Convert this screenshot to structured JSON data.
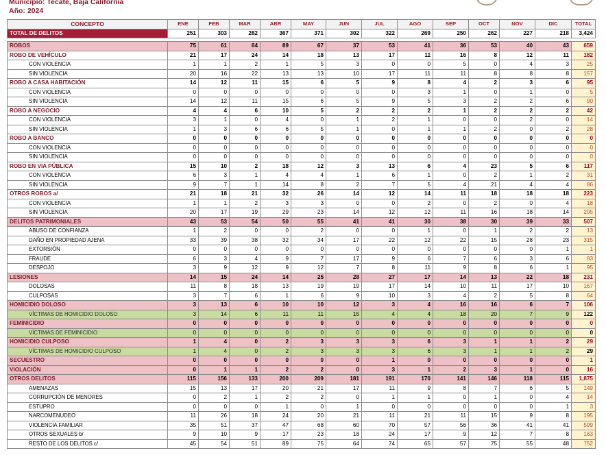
{
  "header": {
    "municipio": "Municipio: Tecate, Baja California",
    "anio": "Año: 2024"
  },
  "table": {
    "headers": [
      "CONCEPTO",
      "ENE",
      "FEB",
      "MAR",
      "ABR",
      "MAY",
      "JUN",
      "JUL",
      "AGO",
      "SEP",
      "OCT",
      "NOV",
      "DIC",
      "TOTAL"
    ],
    "rows": [
      {
        "kind": "grand",
        "label": "TOTAL DE DELITOS",
        "values": [
          "251",
          "303",
          "282",
          "367",
          "371",
          "302",
          "322",
          "269",
          "250",
          "262",
          "227",
          "218"
        ],
        "total": "3,424"
      },
      {
        "kind": "gap"
      },
      {
        "kind": "cat",
        "label": "ROBOS",
        "values": [
          "75",
          "61",
          "64",
          "89",
          "67",
          "37",
          "53",
          "41",
          "36",
          "53",
          "40",
          "43"
        ],
        "total": "659"
      },
      {
        "kind": "sub",
        "label": "ROBO DE VEHÍCULO",
        "values": [
          "21",
          "17",
          "24",
          "14",
          "18",
          "13",
          "17",
          "11",
          "16",
          "8",
          "12",
          "11"
        ],
        "total": "182"
      },
      {
        "kind": "det",
        "label": "CON VIOLENCIA",
        "values": [
          "1",
          "1",
          "2",
          "1",
          "5",
          "3",
          "0",
          "0",
          "5",
          "0",
          "4",
          "3"
        ],
        "total": "25"
      },
      {
        "kind": "det",
        "label": "SIN VIOLENCIA",
        "values": [
          "20",
          "16",
          "22",
          "13",
          "13",
          "10",
          "17",
          "11",
          "11",
          "8",
          "8",
          "8"
        ],
        "total": "157"
      },
      {
        "kind": "sub",
        "label": "ROBO A CASA HABITACIÓN",
        "values": [
          "14",
          "12",
          "11",
          "15",
          "6",
          "5",
          "9",
          "8",
          "4",
          "2",
          "3",
          "6"
        ],
        "total": "95"
      },
      {
        "kind": "det",
        "label": "CON VIOLENCIA",
        "values": [
          "0",
          "0",
          "0",
          "0",
          "0",
          "0",
          "0",
          "3",
          "1",
          "0",
          "1",
          "0"
        ],
        "total": "5"
      },
      {
        "kind": "det",
        "label": "SIN VIOLENCIA",
        "values": [
          "14",
          "12",
          "11",
          "15",
          "6",
          "5",
          "9",
          "5",
          "3",
          "2",
          "2",
          "6"
        ],
        "total": "90"
      },
      {
        "kind": "sub",
        "label": "ROBO A NEGOCIO",
        "values": [
          "4",
          "4",
          "6",
          "10",
          "5",
          "2",
          "2",
          "2",
          "1",
          "2",
          "2",
          "2"
        ],
        "total": "42"
      },
      {
        "kind": "det",
        "label": "CON VIOLENCIA",
        "values": [
          "3",
          "1",
          "0",
          "4",
          "0",
          "1",
          "2",
          "1",
          "0",
          "0",
          "2",
          "0"
        ],
        "total": "14"
      },
      {
        "kind": "det",
        "label": "SIN VIOLENCIA",
        "values": [
          "1",
          "3",
          "6",
          "6",
          "5",
          "1",
          "0",
          "1",
          "1",
          "2",
          "0",
          "2"
        ],
        "total": "28"
      },
      {
        "kind": "sub",
        "label": "ROBO A BANCO",
        "values": [
          "0",
          "0",
          "0",
          "0",
          "0",
          "0",
          "0",
          "0",
          "0",
          "0",
          "0",
          "0"
        ],
        "total": "0"
      },
      {
        "kind": "det",
        "label": "CON VIOLENCIA",
        "values": [
          "0",
          "0",
          "0",
          "0",
          "0",
          "0",
          "0",
          "0",
          "0",
          "0",
          "0",
          "0"
        ],
        "total": "0"
      },
      {
        "kind": "det",
        "label": "SIN VIOLENCIA",
        "values": [
          "0",
          "0",
          "0",
          "0",
          "0",
          "0",
          "0",
          "0",
          "0",
          "0",
          "0",
          "0"
        ],
        "total": "0"
      },
      {
        "kind": "sub",
        "label": "ROBO EN VIA PÚBLICA",
        "values": [
          "15",
          "10",
          "2",
          "18",
          "12",
          "3",
          "13",
          "6",
          "4",
          "23",
          "5",
          "6"
        ],
        "total": "117"
      },
      {
        "kind": "det",
        "label": "CON VIOLENCIA",
        "values": [
          "6",
          "3",
          "1",
          "4",
          "4",
          "1",
          "6",
          "1",
          "0",
          "2",
          "1",
          "2"
        ],
        "total": "31"
      },
      {
        "kind": "det",
        "label": "SIN VIOLENCIA",
        "values": [
          "9",
          "7",
          "1",
          "14",
          "8",
          "2",
          "7",
          "5",
          "4",
          "21",
          "4",
          "4"
        ],
        "total": "86"
      },
      {
        "kind": "sub",
        "label": "OTROS ROBOS a/",
        "values": [
          "21",
          "18",
          "21",
          "32",
          "26",
          "14",
          "12",
          "14",
          "11",
          "18",
          "18",
          "18"
        ],
        "total": "223"
      },
      {
        "kind": "det",
        "label": "CON VIOLENCIA",
        "values": [
          "1",
          "1",
          "2",
          "3",
          "3",
          "0",
          "0",
          "2",
          "0",
          "2",
          "0",
          "4"
        ],
        "total": "18"
      },
      {
        "kind": "det",
        "label": "SIN VIOLENCIA",
        "values": [
          "20",
          "17",
          "19",
          "29",
          "23",
          "14",
          "12",
          "12",
          "11",
          "16",
          "18",
          "14"
        ],
        "total": "205"
      },
      {
        "kind": "cat",
        "label": "DELITOS PATRIMONIALES",
        "values": [
          "43",
          "53",
          "54",
          "50",
          "55",
          "41",
          "41",
          "30",
          "38",
          "30",
          "39",
          "33"
        ],
        "total": "507"
      },
      {
        "kind": "det",
        "label": "ABUSO DE CONFIANZA",
        "values": [
          "1",
          "2",
          "0",
          "0",
          "2",
          "0",
          "0",
          "1",
          "0",
          "1",
          "2",
          "2"
        ],
        "total": "13"
      },
      {
        "kind": "det",
        "label": "DAÑO EN PROPIEDAD AJENA",
        "values": [
          "33",
          "39",
          "38",
          "32",
          "34",
          "17",
          "22",
          "12",
          "22",
          "15",
          "28",
          "23"
        ],
        "total": "315"
      },
      {
        "kind": "det",
        "label": "EXTORSIÓN",
        "values": [
          "0",
          "0",
          "0",
          "0",
          "0",
          "0",
          "0",
          "0",
          "0",
          "0",
          "0",
          "1"
        ],
        "total": "1"
      },
      {
        "kind": "det",
        "label": "FRAUDE",
        "values": [
          "6",
          "3",
          "4",
          "9",
          "7",
          "17",
          "9",
          "6",
          "7",
          "6",
          "3",
          "6"
        ],
        "total": "83"
      },
      {
        "kind": "det",
        "label": "DESPOJO",
        "values": [
          "3",
          "9",
          "12",
          "9",
          "12",
          "7",
          "8",
          "11",
          "9",
          "8",
          "6",
          "1"
        ],
        "total": "95"
      },
      {
        "kind": "cat",
        "label": "LESIONES",
        "values": [
          "14",
          "15",
          "24",
          "14",
          "25",
          "28",
          "27",
          "17",
          "14",
          "13",
          "22",
          "18"
        ],
        "total": "231"
      },
      {
        "kind": "det",
        "label": "DOLOSAS",
        "values": [
          "11",
          "8",
          "18",
          "13",
          "19",
          "19",
          "17",
          "14",
          "10",
          "11",
          "17",
          "10"
        ],
        "total": "167"
      },
      {
        "kind": "det",
        "label": "CULPOSAS",
        "values": [
          "3",
          "7",
          "6",
          "1",
          "6",
          "9",
          "10",
          "3",
          "4",
          "2",
          "5",
          "8"
        ],
        "total": "64"
      },
      {
        "kind": "cat",
        "label": "HOMICIDIO DOLOSO",
        "values": [
          "3",
          "13",
          "6",
          "10",
          "10",
          "12",
          "3",
          "4",
          "16",
          "16",
          "6",
          "7"
        ],
        "total": "106"
      },
      {
        "kind": "vic",
        "label": "VÍCTIMAS DE HOMICIDIO DOLOSO",
        "values": [
          "3",
          "14",
          "6",
          "11",
          "11",
          "15",
          "4",
          "4",
          "18",
          "20",
          "7",
          "9"
        ],
        "total": "122"
      },
      {
        "kind": "cat",
        "label": "FEMINICIDIO",
        "values": [
          "0",
          "0",
          "0",
          "0",
          "0",
          "0",
          "0",
          "0",
          "0",
          "0",
          "0",
          "0"
        ],
        "total": "0"
      },
      {
        "kind": "vic",
        "label": "VÍCTIMAS DE FEMINICIDIO",
        "values": [
          "0",
          "0",
          "0",
          "0",
          "0",
          "0",
          "0",
          "0",
          "0",
          "0",
          "0",
          "0"
        ],
        "total": "0"
      },
      {
        "kind": "cat",
        "label": "HOMICIDIO CULPOSO",
        "values": [
          "1",
          "4",
          "0",
          "2",
          "3",
          "3",
          "3",
          "6",
          "3",
          "1",
          "1",
          "2"
        ],
        "total": "29"
      },
      {
        "kind": "vic",
        "label": "VÍCTIMAS DE HOMICIDIO CULPOSO",
        "values": [
          "1",
          "4",
          "0",
          "2",
          "3",
          "3",
          "3",
          "6",
          "3",
          "1",
          "1",
          "2"
        ],
        "total": "29"
      },
      {
        "kind": "cat",
        "label": "SECUESTRO",
        "values": [
          "0",
          "0",
          "0",
          "0",
          "0",
          "0",
          "1",
          "0",
          "0",
          "0",
          "0",
          "0"
        ],
        "total": "1"
      },
      {
        "kind": "cat",
        "label": "VIOLACIÓN",
        "values": [
          "0",
          "1",
          "1",
          "2",
          "2",
          "0",
          "3",
          "1",
          "2",
          "3",
          "1",
          "0"
        ],
        "total": "16"
      },
      {
        "kind": "cat",
        "label": "OTROS DELITOS",
        "values": [
          "115",
          "156",
          "133",
          "200",
          "209",
          "181",
          "191",
          "170",
          "141",
          "146",
          "118",
          "115"
        ],
        "total": "1,875"
      },
      {
        "kind": "det",
        "label": "AMENAZAS",
        "values": [
          "15",
          "13",
          "17",
          "20",
          "21",
          "17",
          "11",
          "9",
          "8",
          "7",
          "6",
          "5"
        ],
        "total": "149"
      },
      {
        "kind": "det",
        "label": "CORRUPCIÓN DE MENORES",
        "values": [
          "0",
          "2",
          "1",
          "2",
          "2",
          "0",
          "1",
          "1",
          "0",
          "1",
          "0",
          "4"
        ],
        "total": "14"
      },
      {
        "kind": "det",
        "label": "ESTUPRO",
        "values": [
          "0",
          "0",
          "0",
          "1",
          "0",
          "1",
          "0",
          "0",
          "0",
          "0",
          "0",
          "1"
        ],
        "total": "3"
      },
      {
        "kind": "det",
        "label": "NARCOMENUDEO",
        "values": [
          "11",
          "26",
          "18",
          "24",
          "20",
          "21",
          "11",
          "21",
          "11",
          "15",
          "9",
          "8"
        ],
        "total": "195"
      },
      {
        "kind": "det",
        "label": "VIOLENCIA FAMILIAR",
        "values": [
          "35",
          "51",
          "37",
          "47",
          "68",
          "60",
          "70",
          "57",
          "56",
          "36",
          "41",
          "41"
        ],
        "total": "599"
      },
      {
        "kind": "det",
        "label": "OTROS SEXUALES b/",
        "values": [
          "9",
          "10",
          "9",
          "17",
          "23",
          "18",
          "24",
          "17",
          "9",
          "12",
          "7",
          "8"
        ],
        "total": "163"
      },
      {
        "kind": "det",
        "label": "RESTO DE LOS DELITOS c/",
        "values": [
          "45",
          "54",
          "51",
          "89",
          "75",
          "64",
          "74",
          "65",
          "57",
          "75",
          "55",
          "48"
        ],
        "total": "752"
      }
    ]
  }
}
